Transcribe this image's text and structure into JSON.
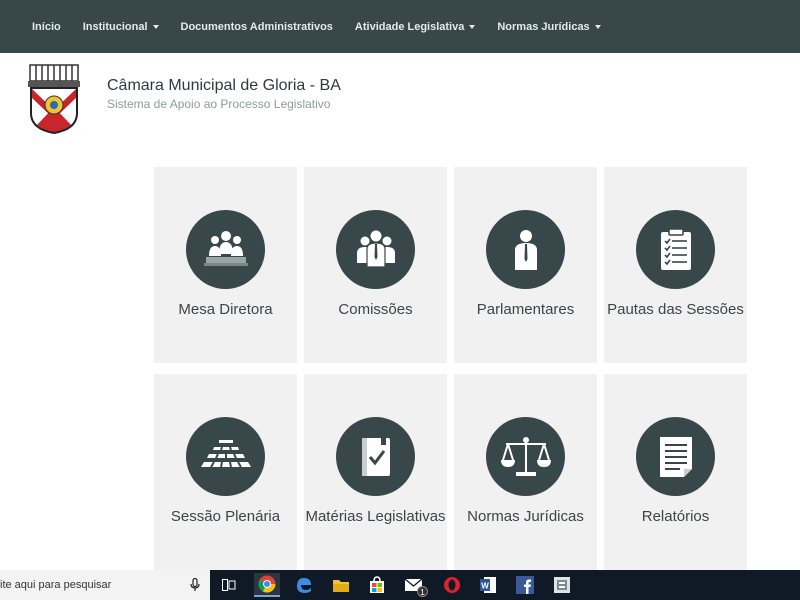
{
  "nav": {
    "items": [
      {
        "label": "Início",
        "dropdown": false
      },
      {
        "label": "Institucional",
        "dropdown": true
      },
      {
        "label": "Documentos Administrativos",
        "dropdown": false
      },
      {
        "label": "Atividade Legislativa",
        "dropdown": true
      },
      {
        "label": "Normas Jurídicas",
        "dropdown": true
      }
    ]
  },
  "header": {
    "title": "Câmara Municipal de Gloria - BA",
    "subtitle": "Sistema de Apoio ao Processo Legislativo"
  },
  "tiles": [
    {
      "label": "Mesa Diretora",
      "icon": "mesa-diretora-icon"
    },
    {
      "label": "Comissões",
      "icon": "commissions-icon"
    },
    {
      "label": "Parlamentares",
      "icon": "parliamentarian-icon"
    },
    {
      "label": "Pautas das Sessões",
      "icon": "clipboard-checklist-icon"
    },
    {
      "label": "Sessão Plenária",
      "icon": "plenary-icon"
    },
    {
      "label": "Matérias Legislativas",
      "icon": "legislative-book-icon"
    },
    {
      "label": "Normas Jurídicas",
      "icon": "scales-icon"
    },
    {
      "label": "Relatórios",
      "icon": "report-icon"
    }
  ],
  "taskbar": {
    "search_placeholder": "ite aqui para pesquisar",
    "mail_badge": "1",
    "icons": [
      "task-view-icon",
      "chrome-icon",
      "edge-icon",
      "file-explorer-icon",
      "store-icon",
      "mail-icon",
      "opera-icon",
      "word-icon",
      "facebook-icon",
      "app-icon"
    ]
  },
  "colors": {
    "navbar": "#37474a",
    "tile_bg": "#f1f1f1",
    "icon_circle": "#37474a",
    "taskbar": "#101a26"
  }
}
